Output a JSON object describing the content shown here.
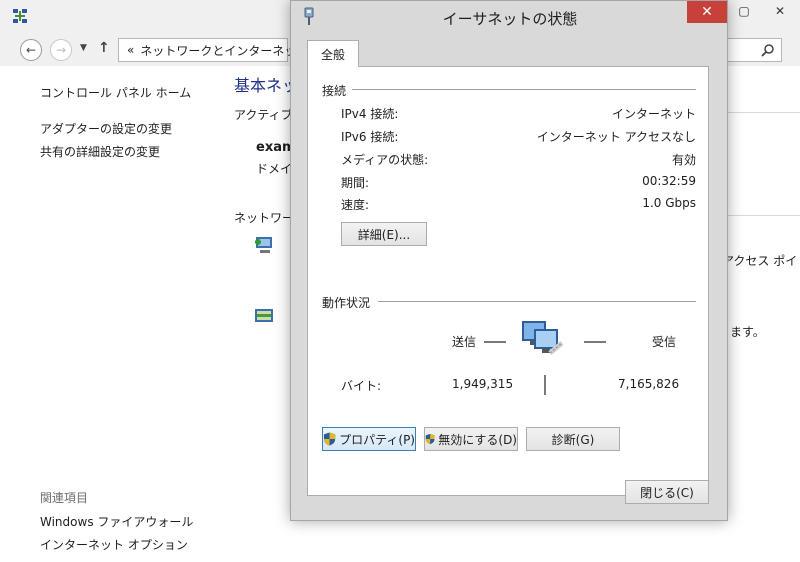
{
  "background": {
    "address": {
      "separator": "«",
      "path": "ネットワークとインターネット"
    },
    "left_pane": {
      "home_link": "コントロール パネル ホーム",
      "adapter_link": "アダプターの設定の変更",
      "sharing_link": "共有の詳細設定の変更",
      "related_heading": "関連項目",
      "firewall_link": "Windows ファイアウォール",
      "internet_options_link": "インターネット オプション"
    },
    "main_pane": {
      "title": "基本ネッ",
      "active_label": "アクティブな",
      "network_name": "exam",
      "domain_label": "ドメイン",
      "settings_label": "ネットワーク設",
      "access_text": "アクセス ポイ",
      "masu_text": "ます。"
    }
  },
  "dialog": {
    "title": "イーサネットの状態",
    "close_glyph": "✕",
    "tab_label": "全般",
    "connection": {
      "heading": "接続",
      "rows": [
        {
          "label": "IPv4 接続:",
          "value": "インターネット"
        },
        {
          "label": "IPv6 接続:",
          "value": "インターネット アクセスなし"
        },
        {
          "label": "メディアの状態:",
          "value": "有効"
        },
        {
          "label": "期間:",
          "value": "00:32:59"
        },
        {
          "label": "速度:",
          "value": "1.0 Gbps"
        }
      ],
      "details_button": "詳細(E)..."
    },
    "activity": {
      "heading": "動作状況",
      "sent_label": "送信",
      "received_label": "受信",
      "bytes_label": "バイト:",
      "bytes_sent": "1,949,315",
      "bytes_received": "7,165,826"
    },
    "buttons": {
      "properties": "プロパティ(P)",
      "disable": "無効にする(D)",
      "diagnose": "診断(G)",
      "close": "閉じる(C)"
    }
  },
  "colors": {
    "close_red": "#c7403a",
    "title_blue": "#1e3287",
    "dialog_gray": "#d9d9d9"
  }
}
